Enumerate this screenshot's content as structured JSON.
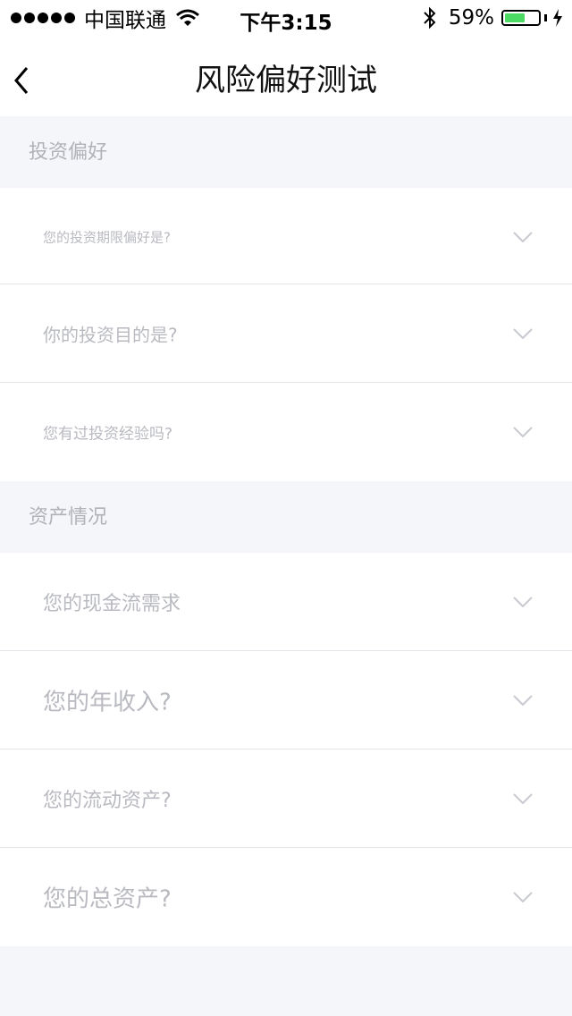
{
  "status": {
    "carrier": "中国联通",
    "time": "下午3:15",
    "battery": "59%",
    "battery_level": 0.59
  },
  "nav": {
    "title": "风险偏好测试",
    "back_icon": "chevron-left-icon"
  },
  "sections": [
    {
      "title": "投资偏好",
      "questions": [
        "您的投资期限偏好是?",
        "你的投资目的是?",
        "您有过投资经验吗?"
      ]
    },
    {
      "title": "资产情况",
      "questions": [
        "您的现金流需求",
        "您的年收入?",
        "您的流动资产?",
        "您的总资产?"
      ]
    }
  ],
  "colors": {
    "background": "#f4f6fa",
    "row_bg": "#ffffff",
    "muted_text": "#b8bac0",
    "battery_green": "#4cd964"
  }
}
